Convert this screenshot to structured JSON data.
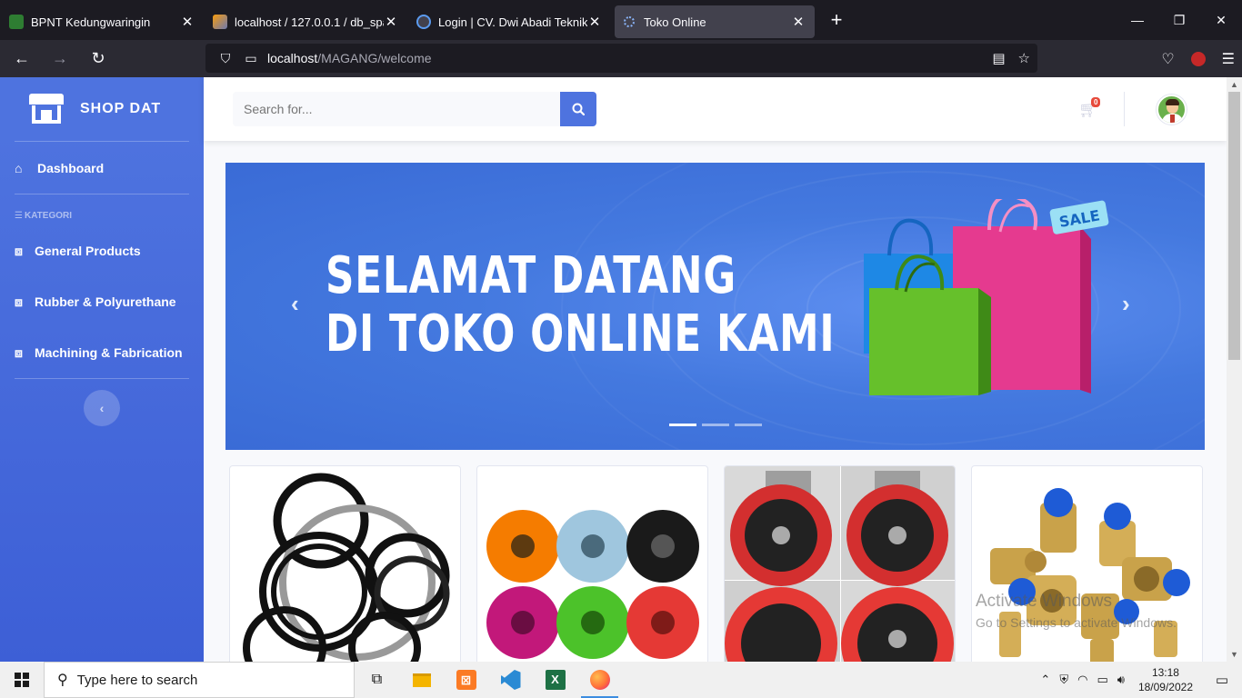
{
  "browser": {
    "tabs": [
      {
        "title": "BPNT Kedungwaringin",
        "active": false
      },
      {
        "title": "localhost / 127.0.0.1 / db_sparep",
        "active": false
      },
      {
        "title": "Login | CV. Dwi Abadi Teknik",
        "active": false
      },
      {
        "title": "Toko Online",
        "active": true
      }
    ],
    "url_host": "localhost",
    "url_path": "/MAGANG/welcome",
    "new_tab_icon": "plus-icon"
  },
  "sidebar": {
    "brand": "SHOP DAT",
    "dashboard": "Dashboard",
    "heading": "KATEGORI",
    "categories": [
      {
        "label": "General Products"
      },
      {
        "label": "Rubber & Polyurethane"
      },
      {
        "label": "Machining & Fabrication"
      }
    ]
  },
  "topbar": {
    "search_placeholder": "Search for...",
    "cart_count": "0"
  },
  "carousel": {
    "line1": "SELAMAT DATANG",
    "line2": "DI TOKO ONLINE KAMI",
    "sale": "SALE",
    "slides": 3,
    "active_slide": 1
  },
  "products": [
    {
      "image": "seal-rings"
    },
    {
      "image": "polyurethane-wheels"
    },
    {
      "image": "red-caster-wheels"
    },
    {
      "image": "brass-pneumatic-fittings"
    }
  ],
  "watermark": {
    "line1": "Activate Windows",
    "line2": "Go to Settings to activate Windows."
  },
  "taskbar": {
    "search": "Type here to search",
    "time": "13:18",
    "date": "18/09/2022"
  },
  "colors": {
    "primary": "#4e73df",
    "danger": "#e74a3b"
  }
}
